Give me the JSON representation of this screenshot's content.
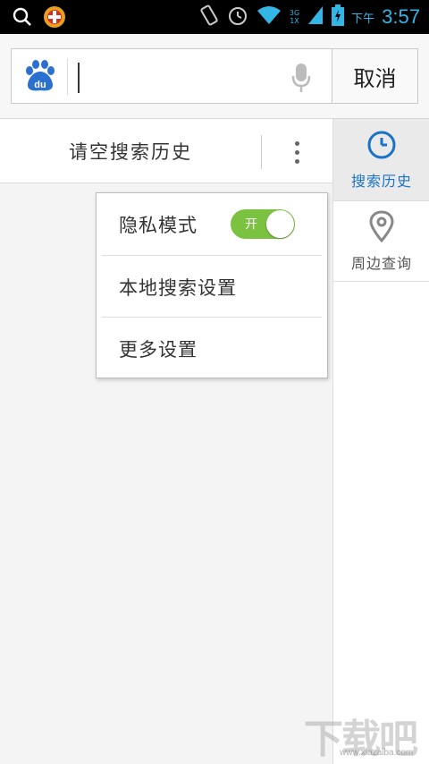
{
  "status_bar": {
    "ampm": "下午",
    "time": "3:57",
    "network_type_top": "3G",
    "network_type_bottom": "1X",
    "icons": [
      "search-icon",
      "app-notification-icon",
      "vibrate-icon",
      "alarm-icon",
      "wifi-icon",
      "signal-icon",
      "battery-charging-icon"
    ]
  },
  "search": {
    "input_value": "",
    "placeholder": "",
    "cancel_label": "取消",
    "logo_text": "du"
  },
  "history_bar": {
    "clear_label": "请空搜索历史"
  },
  "sidebar": {
    "tabs": [
      {
        "label": "搜索历史",
        "icon": "clock-icon",
        "active": true
      },
      {
        "label": "周边查询",
        "icon": "location-pin-icon",
        "active": false
      }
    ]
  },
  "menu": {
    "items": [
      {
        "label": "隐私模式",
        "toggle": {
          "state_label": "开",
          "on": true
        }
      },
      {
        "label": "本地搜索设置"
      },
      {
        "label": "更多设置"
      }
    ]
  },
  "watermark": {
    "text": "下载吧",
    "url": "www.xiazaiba.com"
  },
  "colors": {
    "accent_blue": "#1a73c7",
    "status_blue": "#33b5e5",
    "toggle_green": "#7cc241"
  }
}
